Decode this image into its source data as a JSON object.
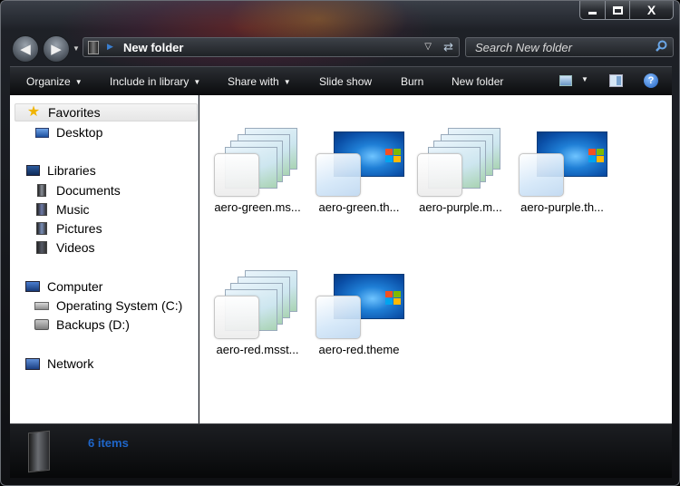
{
  "window": {
    "caption_close": "X"
  },
  "navigation": {
    "back_glyph": "◀",
    "forward_glyph": "▶",
    "history_dropdown_glyph": "▼"
  },
  "address_bar": {
    "path": "New folder",
    "separator_glyph": "▶",
    "dropdown_glyph": "▽",
    "refresh_glyph": "⇄"
  },
  "search": {
    "placeholder": "Search New folder",
    "icon": "search-icon"
  },
  "toolbar": {
    "organize": "Organize",
    "include_in_library": "Include in library",
    "share_with": "Share with",
    "slide_show": "Slide show",
    "burn": "Burn",
    "new_folder": "New folder",
    "caret": "▼",
    "help": "?"
  },
  "nav_pane": {
    "favorites": "Favorites",
    "desktop": "Desktop",
    "libraries": "Libraries",
    "documents": "Documents",
    "music": "Music",
    "pictures": "Pictures",
    "videos": "Videos",
    "computer": "Computer",
    "operating_system": "Operating System (C:)",
    "backups": "Backups (D:)",
    "network": "Network"
  },
  "files": [
    {
      "name": "aero-green.ms...",
      "kind": "msstyles"
    },
    {
      "name": "aero-green.th...",
      "kind": "theme"
    },
    {
      "name": "aero-purple.m...",
      "kind": "msstyles"
    },
    {
      "name": "aero-purple.th...",
      "kind": "theme"
    },
    {
      "name": "aero-red.msst...",
      "kind": "msstyles"
    },
    {
      "name": "aero-red.theme",
      "kind": "theme"
    }
  ],
  "status": {
    "item_count": "6 items"
  }
}
